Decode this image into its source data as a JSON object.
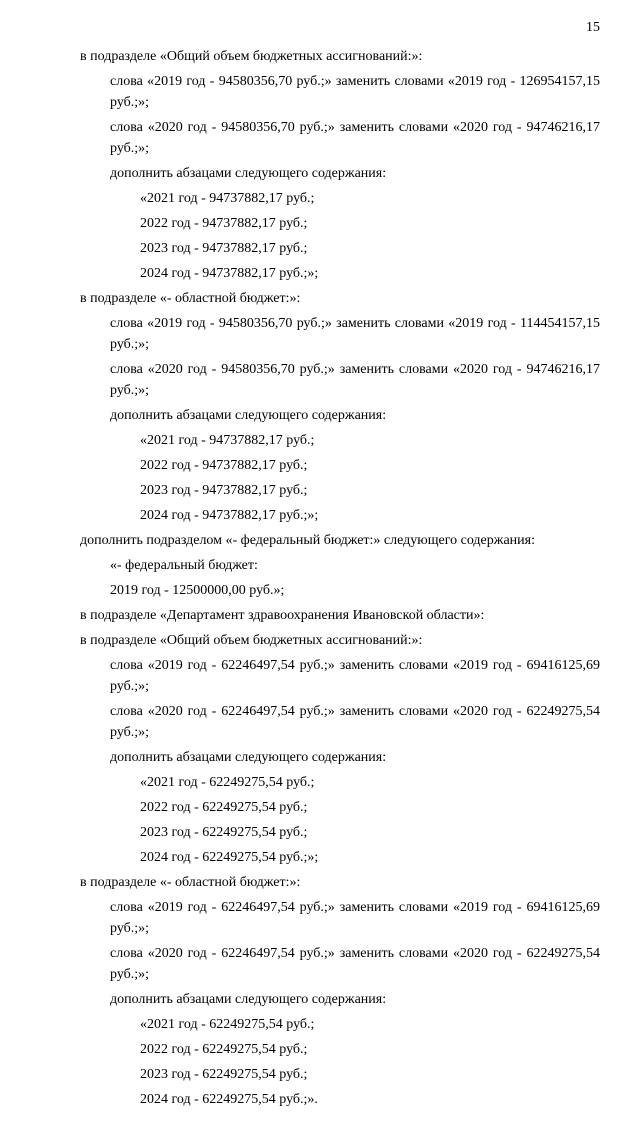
{
  "page": {
    "number": "15",
    "lines": [
      {
        "indent": 1,
        "text": "в подразделе «Общий объем бюджетных ассигнований:»:"
      },
      {
        "indent": 2,
        "text": "слова «2019 год - 94580356,70 руб.;» заменить словами «2019 год - 126954157,15 руб.;»;"
      },
      {
        "indent": 2,
        "text": "слова «2020 год - 94580356,70 руб.;» заменить словами «2020 год - 94746216,17 руб.;»;"
      },
      {
        "indent": 2,
        "text": "дополнить абзацами следующего содержания:"
      },
      {
        "indent": 3,
        "text": "«2021 год - 94737882,17 руб.;"
      },
      {
        "indent": 3,
        "text": "2022 год - 94737882,17 руб.;"
      },
      {
        "indent": 3,
        "text": "2023 год - 94737882,17 руб.;"
      },
      {
        "indent": 3,
        "text": "2024 год - 94737882,17 руб.;»;"
      },
      {
        "indent": 1,
        "text": "в подразделе «- областной бюджет:»:"
      },
      {
        "indent": 2,
        "text": "слова «2019 год - 94580356,70 руб.;» заменить словами «2019 год - 114454157,15 руб.;»;"
      },
      {
        "indent": 2,
        "text": "слова «2020 год - 94580356,70 руб.;» заменить словами «2020 год - 94746216,17 руб.;»;"
      },
      {
        "indent": 2,
        "text": "дополнить абзацами следующего содержания:"
      },
      {
        "indent": 3,
        "text": "«2021 год - 94737882,17 руб.;"
      },
      {
        "indent": 3,
        "text": "2022 год - 94737882,17 руб.;"
      },
      {
        "indent": 3,
        "text": "2023 год - 94737882,17 руб.;"
      },
      {
        "indent": 3,
        "text": "2024 год - 94737882,17 руб.;»;"
      },
      {
        "indent": 1,
        "text": "дополнить подразделом «- федеральный бюджет:» следующего содержания:"
      },
      {
        "indent": 2,
        "text": "«- федеральный бюджет:"
      },
      {
        "indent": 2,
        "text": "2019 год - 12500000,00 руб.»;"
      },
      {
        "indent": 1,
        "text": "в подразделе «Департамент здравоохранения Ивановской области»:"
      },
      {
        "indent": 1,
        "text": "в подразделе «Общий объем бюджетных ассигнований:»:"
      },
      {
        "indent": 2,
        "text": "слова «2019 год - 62246497,54 руб.;» заменить словами «2019 год - 69416125,69 руб.;»;"
      },
      {
        "indent": 2,
        "text": "слова «2020 год - 62246497,54 руб.;» заменить словами «2020 год - 62249275,54 руб.;»;"
      },
      {
        "indent": 2,
        "text": "дополнить абзацами следующего содержания:"
      },
      {
        "indent": 3,
        "text": "«2021 год - 62249275,54 руб.;"
      },
      {
        "indent": 3,
        "text": "2022 год - 62249275,54 руб.;"
      },
      {
        "indent": 3,
        "text": "2023 год - 62249275,54 руб.;"
      },
      {
        "indent": 3,
        "text": "2024 год - 62249275,54 руб.;»;"
      },
      {
        "indent": 1,
        "text": "в подразделе «- областной бюджет:»:"
      },
      {
        "indent": 2,
        "text": "слова «2019 год - 62246497,54 руб.;» заменить словами «2019 год - 69416125,69 руб.;»;"
      },
      {
        "indent": 2,
        "text": "слова «2020 год - 62246497,54 руб.;» заменить словами «2020 год - 62249275,54 руб.;»;"
      },
      {
        "indent": 2,
        "text": "дополнить абзацами следующего содержания:"
      },
      {
        "indent": 3,
        "text": "«2021 год - 62249275,54 руб.;"
      },
      {
        "indent": 3,
        "text": "2022 год - 62249275,54 руб.;"
      },
      {
        "indent": 3,
        "text": "2023 год - 62249275,54 руб.;"
      },
      {
        "indent": 3,
        "text": "2024 год - 62249275,54 руб.;»."
      }
    ]
  }
}
